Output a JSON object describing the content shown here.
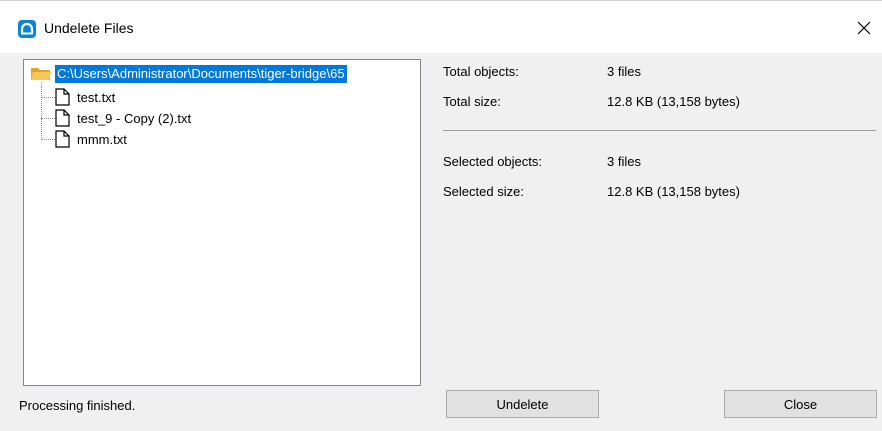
{
  "window": {
    "title": "Undelete Files",
    "close_glyph": "✕",
    "icons": {
      "app": "app-cloud-icon",
      "close": "close-icon"
    }
  },
  "tree": {
    "root": {
      "label": "C:\\Users\\Administrator\\Documents\\tiger-bridge\\65",
      "icon": "folder-open-icon",
      "selected": true
    },
    "items": [
      {
        "label": "test.txt",
        "icon": "file-icon"
      },
      {
        "label": "test_9 - Copy (2).txt",
        "icon": "file-icon"
      },
      {
        "label": "mmm.txt",
        "icon": "file-icon"
      }
    ]
  },
  "summary": {
    "total_objects_label": "Total objects:",
    "total_objects_value": "3 files",
    "total_size_label": "Total size:",
    "total_size_value": "12.8 KB (13,158 bytes)",
    "selected_objects_label": "Selected objects:",
    "selected_objects_value": "3 files",
    "selected_size_label": "Selected size:",
    "selected_size_value": "12.8 KB (13,158 bytes)"
  },
  "buttons": {
    "undelete": "Undelete",
    "close": "Close"
  },
  "status": {
    "text": "Processing finished."
  },
  "colors": {
    "selection": "#0078d7",
    "app_icon": "#0a84d6",
    "folder": "#f0b43a"
  }
}
